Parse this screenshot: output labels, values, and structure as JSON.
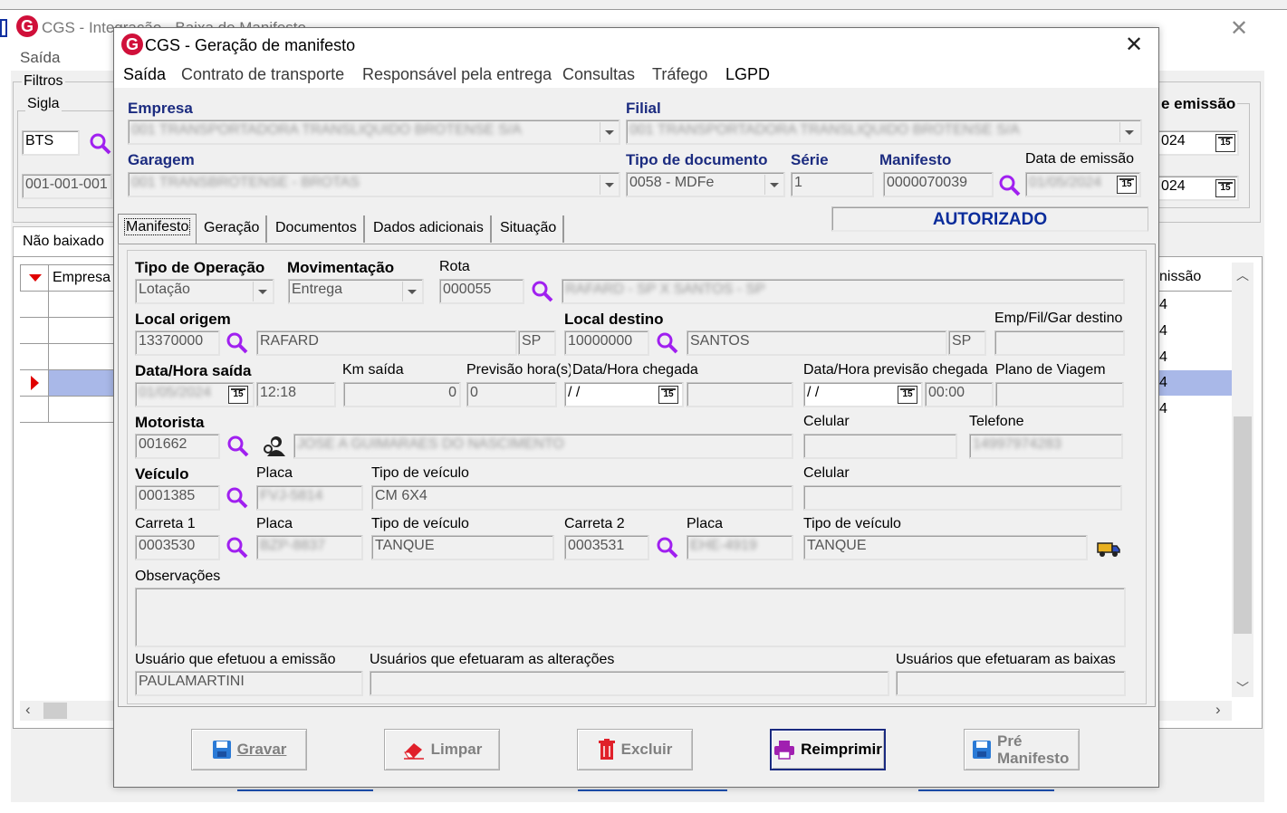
{
  "background_window": {
    "title": "CGS - Integração - Baixa de Manifesto",
    "menu_saida": "Saída",
    "filters_label": "Filtros",
    "sigla_label": "Sigla",
    "sigla_value": "BTS",
    "empresa_code": "001-001-001",
    "emissao_label": "e emissão",
    "date1": "024",
    "date2": "024",
    "nao_baixado_label": "Não baixado",
    "grid_col_empresa": "Empresa",
    "grid_col_emissao": "nissão",
    "grid_rows_right": [
      "4",
      "4",
      "4",
      "4",
      "4"
    ]
  },
  "dialog": {
    "title": "CGS - Geração de manifesto",
    "menu": [
      "Saída",
      "Contrato de transporte",
      "Responsável pela entrega",
      "Consultas",
      "Tráfego",
      "LGPD"
    ],
    "empresa_label": "Empresa",
    "empresa_value": "001 TRANSPORTADORA TRANSLIQUIDO BROTENSE S/A",
    "filial_label": "Filial",
    "filial_value": "001 TRANSPORTADORA TRANSLIQUIDO BROTENSE S/A",
    "garagem_label": "Garagem",
    "garagem_value": "001 TRANSBROTENSE - BROTAS",
    "tipo_doc_label": "Tipo de documento",
    "tipo_doc_value": "0058 - MDFe",
    "serie_label": "Série",
    "serie_value": "1",
    "manifesto_label": "Manifesto",
    "manifesto_value": "0000070039",
    "data_emissao_label": "Data de emissão",
    "data_emissao_value": "01/05/2024",
    "status": "AUTORIZADO",
    "tabs": [
      "Manifesto",
      "Geração",
      "Documentos",
      "Dados adicionais",
      "Situação"
    ],
    "tipo_operacao_label": "Tipo de Operação",
    "tipo_operacao_value": "Lotação",
    "movimentacao_label": "Movimentação",
    "movimentacao_value": "Entrega",
    "rota_label": "Rota",
    "rota_value": "000055",
    "rota_desc": "RAFARD - SP X SANTOS - SP",
    "local_origem_label": "Local origem",
    "local_origem_code": "13370000",
    "local_origem_name": "RAFARD",
    "local_origem_uf": "SP",
    "local_destino_label": "Local destino",
    "local_destino_code": "10000000",
    "local_destino_name": "SANTOS",
    "local_destino_uf": "SP",
    "emp_fil_gar_label": "Emp/Fil/Gar destino",
    "data_hora_saida_label": "Data/Hora saída",
    "data_saida_value": "01/05/2024",
    "hora_saida_value": "12:18",
    "km_saida_label": "Km saída",
    "km_saida_value": "0",
    "previsao_label": "Previsão hora(s)",
    "previsao_value": "0",
    "data_hora_chegada_label": "Data/Hora chegada",
    "data_chegada_value": " / /",
    "data_hora_prev_label": "Data/Hora previsão chegada",
    "data_prev_value": " / /",
    "hora_prev_value": "00:00",
    "plano_viagem_label": "Plano de Viagem",
    "motorista_label": "Motorista",
    "motorista_code": "001662",
    "motorista_name": "JOSE A GUIMARAES DO NASCIMENTO",
    "celular_label": "Celular",
    "telefone_label": "Telefone",
    "telefone_value": "14997974283",
    "veiculo_label": "Veículo",
    "veiculo_code": "0001385",
    "placa_label": "Placa",
    "veiculo_placa": "FVJ-5814",
    "tipo_veiculo_label": "Tipo de veículo",
    "veiculo_tipo": "CM 6X4",
    "celular2_label": "Celular",
    "carreta1_label": "Carreta 1",
    "carreta1_code": "0003530",
    "carreta1_placa": "BZP-8837",
    "carreta1_tipo": "TANQUE",
    "carreta2_label": "Carreta 2",
    "carreta2_code": "0003531",
    "carreta2_placa": "EHE-4919",
    "carreta2_tipo": "TANQUE",
    "observacoes_label": "Observações",
    "usuario_emissao_label": "Usuário que efetuou a emissão",
    "usuario_emissao_value": "PAULAMARTINI",
    "usuarios_alteracoes_label": "Usuários que efetuaram as alterações",
    "usuarios_baixas_label": "Usuários que efetuaram as baixas",
    "buttons": {
      "gravar": "Gravar",
      "limpar": "Limpar",
      "excluir": "Excluir",
      "reimprimir": "Reimprimir",
      "pre_manifesto_1": "Pré",
      "pre_manifesto_2": "Manifesto"
    }
  },
  "colors": {
    "accent_purple": "#a020f0",
    "status_blue": "#0a2c9b",
    "logo_red": "#d0103a",
    "selection_blue": "#a9b8e8"
  }
}
